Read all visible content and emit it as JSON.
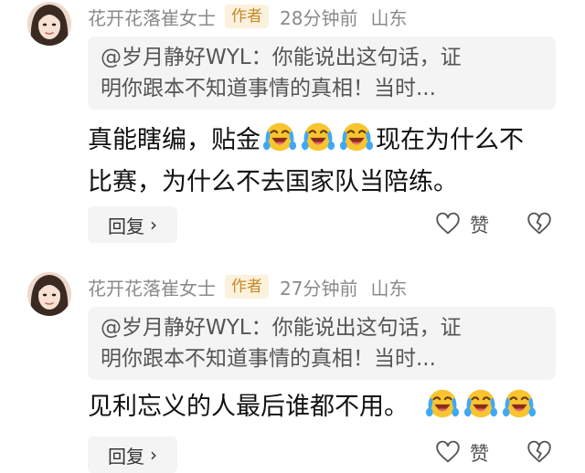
{
  "comments": [
    {
      "author": "花开花落崔女士",
      "badge": "作者",
      "time": "28分钟前",
      "location": "山东",
      "quote_line1": "@岁月静好WYL：你能说出这句话，证",
      "quote_line2": "明你跟本不知道事情的真相！当时...",
      "text_line1a": "真能瞎编，贴金",
      "text_line1b": "现在为什么不",
      "text_line2": "比赛，为什么不去国家队当陪练。",
      "emoji": "face-with-tears-of-joy-icon",
      "reply_label": "回复",
      "like_label": "赞"
    },
    {
      "author": "花开花落崔女士",
      "badge": "作者",
      "time": "27分钟前",
      "location": "山东",
      "quote_line1": "@岁月静好WYL：你能说出这句话，证",
      "quote_line2": "明你跟本不知道事情的真相！当时...",
      "text_line1": "见利忘义的人最后谁都不用。",
      "emoji": "face-with-tears-of-joy-icon",
      "reply_label": "回复",
      "like_label": "赞"
    }
  ],
  "colors": {
    "meta_gray": "#8a8a8a",
    "badge_text": "#c58a2a",
    "badge_bg": "#fbf1dc",
    "quote_bg": "#f4f4f4"
  }
}
